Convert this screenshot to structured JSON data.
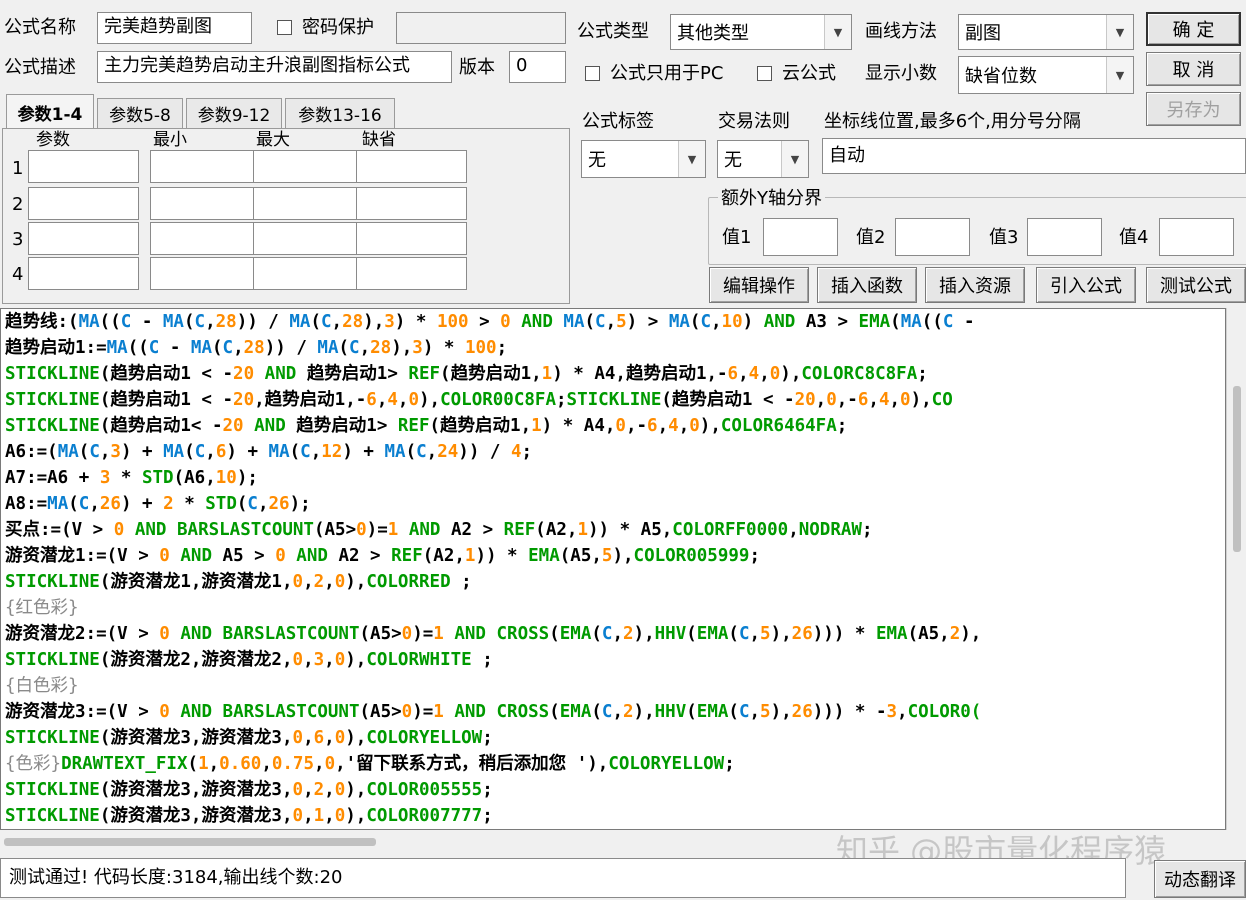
{
  "form": {
    "name_label": "公式名称",
    "name_value": "完美趋势副图",
    "pwd_label": "密码保护",
    "desc_label": "公式描述",
    "desc_value": "主力完美趋势启动主升浪副图指标公式",
    "version_label": "版本",
    "version_value": "0",
    "type_label": "公式类型",
    "type_value": "其他类型",
    "draw_label": "画线方法",
    "draw_value": "副图",
    "pc_only_label": "公式只用于PC",
    "cloud_label": "云公式",
    "decimals_label": "显示小数",
    "decimals_value": "缺省位数",
    "tag_label": "公式标签",
    "tag_value": "无",
    "trade_label": "交易法则",
    "trade_value": "无",
    "axis_label": "坐标线位置,最多6个,用分号分隔",
    "axis_value": "自动",
    "yaxis_group": "额外Y轴分界",
    "v1": "值1",
    "v2": "值2",
    "v3": "值3",
    "v4": "值4"
  },
  "buttons": {
    "ok": "确 定",
    "cancel": "取 消",
    "saveas": "另存为",
    "edit": "编辑操作",
    "insert_func": "插入函数",
    "insert_res": "插入资源",
    "import": "引入公式",
    "test": "测试公式",
    "translate": "动态翻译"
  },
  "tabs": [
    "参数1-4",
    "参数5-8",
    "参数9-12",
    "参数13-16"
  ],
  "params": {
    "headers": [
      "参数",
      "最小",
      "最大",
      "缺省"
    ],
    "rows": [
      "1",
      "2",
      "3",
      "4"
    ]
  },
  "code_lines": [
    [
      [
        "k",
        "趋势线:("
      ],
      [
        "f",
        "MA"
      ],
      [
        "k",
        "(("
      ],
      [
        "f",
        "C"
      ],
      [
        "k",
        " - "
      ],
      [
        "f",
        "MA"
      ],
      [
        "k",
        "("
      ],
      [
        "f",
        "C"
      ],
      [
        "k",
        ","
      ],
      [
        "n",
        "28"
      ],
      [
        "k",
        ")) / "
      ],
      [
        "f",
        "MA"
      ],
      [
        "k",
        "("
      ],
      [
        "f",
        "C"
      ],
      [
        "k",
        ","
      ],
      [
        "n",
        "28"
      ],
      [
        "k",
        "),"
      ],
      [
        "n",
        "3"
      ],
      [
        "k",
        ") * "
      ],
      [
        "n",
        "100"
      ],
      [
        "k",
        " > "
      ],
      [
        "n",
        "0"
      ],
      [
        "g",
        " AND "
      ],
      [
        "f",
        "MA"
      ],
      [
        "k",
        "("
      ],
      [
        "f",
        "C"
      ],
      [
        "k",
        ","
      ],
      [
        "n",
        "5"
      ],
      [
        "k",
        ") > "
      ],
      [
        "f",
        "MA"
      ],
      [
        "k",
        "("
      ],
      [
        "f",
        "C"
      ],
      [
        "k",
        ","
      ],
      [
        "n",
        "10"
      ],
      [
        "k",
        ")"
      ],
      [
        "g",
        " AND "
      ],
      [
        "k",
        "A3 > "
      ],
      [
        "g",
        "EMA"
      ],
      [
        "k",
        "("
      ],
      [
        "f",
        "MA"
      ],
      [
        "k",
        "(("
      ],
      [
        "f",
        "C"
      ],
      [
        "k",
        " -"
      ]
    ],
    [
      [
        "k",
        "趋势启动1:="
      ],
      [
        "f",
        "MA"
      ],
      [
        "k",
        "(("
      ],
      [
        "f",
        "C"
      ],
      [
        "k",
        " - "
      ],
      [
        "f",
        "MA"
      ],
      [
        "k",
        "("
      ],
      [
        "f",
        "C"
      ],
      [
        "k",
        ","
      ],
      [
        "n",
        "28"
      ],
      [
        "k",
        ")) / "
      ],
      [
        "f",
        "MA"
      ],
      [
        "k",
        "("
      ],
      [
        "f",
        "C"
      ],
      [
        "k",
        ","
      ],
      [
        "n",
        "28"
      ],
      [
        "k",
        "),"
      ],
      [
        "n",
        "3"
      ],
      [
        "k",
        ") * "
      ],
      [
        "n",
        "100"
      ],
      [
        "k",
        ";"
      ]
    ],
    [
      [
        "g",
        "STICKLINE"
      ],
      [
        "k",
        "(趋势启动1 < -"
      ],
      [
        "n",
        "20"
      ],
      [
        "g",
        " AND "
      ],
      [
        "k",
        "趋势启动1> "
      ],
      [
        "g",
        "REF"
      ],
      [
        "k",
        "(趋势启动1,"
      ],
      [
        "n",
        "1"
      ],
      [
        "k",
        ") * A4,趋势启动1,-"
      ],
      [
        "n",
        "6"
      ],
      [
        "k",
        ","
      ],
      [
        "n",
        "4"
      ],
      [
        "k",
        ","
      ],
      [
        "n",
        "0"
      ],
      [
        "k",
        "),"
      ],
      [
        "g",
        "COLORC8C8FA"
      ],
      [
        "k",
        ";"
      ]
    ],
    [
      [
        "g",
        "STICKLINE"
      ],
      [
        "k",
        "(趋势启动1 < -"
      ],
      [
        "n",
        "20"
      ],
      [
        "k",
        ",趋势启动1,-"
      ],
      [
        "n",
        "6"
      ],
      [
        "k",
        ","
      ],
      [
        "n",
        "4"
      ],
      [
        "k",
        ","
      ],
      [
        "n",
        "0"
      ],
      [
        "k",
        "),"
      ],
      [
        "g",
        "COLOR00C8FA"
      ],
      [
        "k",
        ";"
      ],
      [
        "g",
        "STICKLINE"
      ],
      [
        "k",
        "(趋势启动1 < -"
      ],
      [
        "n",
        "20"
      ],
      [
        "k",
        ","
      ],
      [
        "n",
        "0"
      ],
      [
        "k",
        ",-"
      ],
      [
        "n",
        "6"
      ],
      [
        "k",
        ","
      ],
      [
        "n",
        "4"
      ],
      [
        "k",
        ","
      ],
      [
        "n",
        "0"
      ],
      [
        "k",
        "),"
      ],
      [
        "g",
        "CO"
      ]
    ],
    [
      [
        "g",
        "STICKLINE"
      ],
      [
        "k",
        "(趋势启动1< -"
      ],
      [
        "n",
        "20"
      ],
      [
        "g",
        " AND "
      ],
      [
        "k",
        "趋势启动1> "
      ],
      [
        "g",
        "REF"
      ],
      [
        "k",
        "(趋势启动1,"
      ],
      [
        "n",
        "1"
      ],
      [
        "k",
        ") * A4,"
      ],
      [
        "n",
        "0"
      ],
      [
        "k",
        ",-"
      ],
      [
        "n",
        "6"
      ],
      [
        "k",
        ","
      ],
      [
        "n",
        "4"
      ],
      [
        "k",
        ","
      ],
      [
        "n",
        "0"
      ],
      [
        "k",
        "),"
      ],
      [
        "g",
        "COLOR6464FA"
      ],
      [
        "k",
        ";"
      ]
    ],
    [
      [
        "k",
        "A6:=("
      ],
      [
        "f",
        "MA"
      ],
      [
        "k",
        "("
      ],
      [
        "f",
        "C"
      ],
      [
        "k",
        ","
      ],
      [
        "n",
        "3"
      ],
      [
        "k",
        ") + "
      ],
      [
        "f",
        "MA"
      ],
      [
        "k",
        "("
      ],
      [
        "f",
        "C"
      ],
      [
        "k",
        ","
      ],
      [
        "n",
        "6"
      ],
      [
        "k",
        ") + "
      ],
      [
        "f",
        "MA"
      ],
      [
        "k",
        "("
      ],
      [
        "f",
        "C"
      ],
      [
        "k",
        ","
      ],
      [
        "n",
        "12"
      ],
      [
        "k",
        ") + "
      ],
      [
        "f",
        "MA"
      ],
      [
        "k",
        "("
      ],
      [
        "f",
        "C"
      ],
      [
        "k",
        ","
      ],
      [
        "n",
        "24"
      ],
      [
        "k",
        ")) / "
      ],
      [
        "n",
        "4"
      ],
      [
        "k",
        ";"
      ]
    ],
    [
      [
        "k",
        "A7:=A6 + "
      ],
      [
        "n",
        "3"
      ],
      [
        "k",
        " * "
      ],
      [
        "g",
        "STD"
      ],
      [
        "k",
        "(A6,"
      ],
      [
        "n",
        "10"
      ],
      [
        "k",
        ");"
      ]
    ],
    [
      [
        "k",
        "A8:="
      ],
      [
        "f",
        "MA"
      ],
      [
        "k",
        "("
      ],
      [
        "f",
        "C"
      ],
      [
        "k",
        ","
      ],
      [
        "n",
        "26"
      ],
      [
        "k",
        ") + "
      ],
      [
        "n",
        "2"
      ],
      [
        "k",
        " * "
      ],
      [
        "g",
        "STD"
      ],
      [
        "k",
        "("
      ],
      [
        "f",
        "C"
      ],
      [
        "k",
        ","
      ],
      [
        "n",
        "26"
      ],
      [
        "k",
        ");"
      ]
    ],
    [
      [
        "k",
        "买点:=(V > "
      ],
      [
        "n",
        "0"
      ],
      [
        "g",
        " AND "
      ],
      [
        "g",
        "BARSLASTCOUNT"
      ],
      [
        "k",
        "(A5>"
      ],
      [
        "n",
        "0"
      ],
      [
        "k",
        ")="
      ],
      [
        "n",
        "1"
      ],
      [
        "g",
        " AND "
      ],
      [
        "k",
        "A2 > "
      ],
      [
        "g",
        "REF"
      ],
      [
        "k",
        "(A2,"
      ],
      [
        "n",
        "1"
      ],
      [
        "k",
        ")) * A5,"
      ],
      [
        "g",
        "COLORFF0000"
      ],
      [
        "k",
        ","
      ],
      [
        "g",
        "NODRAW"
      ],
      [
        "k",
        ";"
      ]
    ],
    [
      [
        "k",
        "游资潜龙1:=(V > "
      ],
      [
        "n",
        "0"
      ],
      [
        "g",
        " AND "
      ],
      [
        "k",
        "A5 > "
      ],
      [
        "n",
        "0"
      ],
      [
        "g",
        " AND "
      ],
      [
        "k",
        "A2 > "
      ],
      [
        "g",
        "REF"
      ],
      [
        "k",
        "(A2,"
      ],
      [
        "n",
        "1"
      ],
      [
        "k",
        ")) * "
      ],
      [
        "g",
        "EMA"
      ],
      [
        "k",
        "(A5,"
      ],
      [
        "n",
        "5"
      ],
      [
        "k",
        "),"
      ],
      [
        "g",
        "COLOR005999"
      ],
      [
        "k",
        ";"
      ]
    ],
    [
      [
        "g",
        "STICKLINE"
      ],
      [
        "k",
        "(游资潜龙1,游资潜龙1,"
      ],
      [
        "n",
        "0"
      ],
      [
        "k",
        ","
      ],
      [
        "n",
        "2"
      ],
      [
        "k",
        ","
      ],
      [
        "n",
        "0"
      ],
      [
        "k",
        "),"
      ],
      [
        "g",
        "COLORRED"
      ],
      [
        "k",
        " ;"
      ]
    ],
    [
      [
        "c",
        "{红色彩}"
      ]
    ],
    [
      [
        "k",
        "游资潜龙2:=(V > "
      ],
      [
        "n",
        "0"
      ],
      [
        "g",
        " AND "
      ],
      [
        "g",
        "BARSLASTCOUNT"
      ],
      [
        "k",
        "(A5>"
      ],
      [
        "n",
        "0"
      ],
      [
        "k",
        ")="
      ],
      [
        "n",
        "1"
      ],
      [
        "g",
        " AND "
      ],
      [
        "g",
        "CROSS"
      ],
      [
        "k",
        "("
      ],
      [
        "g",
        "EMA"
      ],
      [
        "k",
        "("
      ],
      [
        "f",
        "C"
      ],
      [
        "k",
        ","
      ],
      [
        "n",
        "2"
      ],
      [
        "k",
        "),"
      ],
      [
        "g",
        "HHV"
      ],
      [
        "k",
        "("
      ],
      [
        "g",
        "EMA"
      ],
      [
        "k",
        "("
      ],
      [
        "f",
        "C"
      ],
      [
        "k",
        ","
      ],
      [
        "n",
        "5"
      ],
      [
        "k",
        "),"
      ],
      [
        "n",
        "26"
      ],
      [
        "k",
        ")))"
      ],
      [
        "k",
        " * "
      ],
      [
        "g",
        "EMA"
      ],
      [
        "k",
        "(A5,"
      ],
      [
        "n",
        "2"
      ],
      [
        "k",
        "),"
      ]
    ],
    [
      [
        "g",
        "STICKLINE"
      ],
      [
        "k",
        "(游资潜龙2,游资潜龙2,"
      ],
      [
        "n",
        "0"
      ],
      [
        "k",
        ","
      ],
      [
        "n",
        "3"
      ],
      [
        "k",
        ","
      ],
      [
        "n",
        "0"
      ],
      [
        "k",
        "),"
      ],
      [
        "g",
        "COLORWHITE"
      ],
      [
        "k",
        " ;"
      ]
    ],
    [
      [
        "c",
        "{白色彩}"
      ]
    ],
    [
      [
        "k",
        "游资潜龙3:=(V > "
      ],
      [
        "n",
        "0"
      ],
      [
        "g",
        " AND "
      ],
      [
        "g",
        "BARSLASTCOUNT"
      ],
      [
        "k",
        "(A5>"
      ],
      [
        "n",
        "0"
      ],
      [
        "k",
        ")="
      ],
      [
        "n",
        "1"
      ],
      [
        "g",
        " AND "
      ],
      [
        "g",
        "CROSS"
      ],
      [
        "k",
        "("
      ],
      [
        "g",
        "EMA"
      ],
      [
        "k",
        "("
      ],
      [
        "f",
        "C"
      ],
      [
        "k",
        ","
      ],
      [
        "n",
        "2"
      ],
      [
        "k",
        "),"
      ],
      [
        "g",
        "HHV"
      ],
      [
        "k",
        "("
      ],
      [
        "g",
        "EMA"
      ],
      [
        "k",
        "("
      ],
      [
        "f",
        "C"
      ],
      [
        "k",
        ","
      ],
      [
        "n",
        "5"
      ],
      [
        "k",
        "),"
      ],
      [
        "n",
        "26"
      ],
      [
        "k",
        ")))"
      ],
      [
        "k",
        " * -"
      ],
      [
        "n",
        "3"
      ],
      [
        "k",
        ","
      ],
      [
        "g",
        "COLOR0("
      ]
    ],
    [
      [
        "g",
        "STICKLINE"
      ],
      [
        "k",
        "(游资潜龙3,游资潜龙3,"
      ],
      [
        "n",
        "0"
      ],
      [
        "k",
        ","
      ],
      [
        "n",
        "6"
      ],
      [
        "k",
        ","
      ],
      [
        "n",
        "0"
      ],
      [
        "k",
        "),"
      ],
      [
        "g",
        "COLORYELLOW"
      ],
      [
        "k",
        ";"
      ]
    ],
    [
      [
        "c",
        "{色彩}"
      ],
      [
        "g",
        "DRAWTEXT_FIX"
      ],
      [
        "k",
        "("
      ],
      [
        "n",
        "1"
      ],
      [
        "k",
        ","
      ],
      [
        "n",
        "0.60"
      ],
      [
        "k",
        ","
      ],
      [
        "n",
        "0.75"
      ],
      [
        "k",
        ","
      ],
      [
        "n",
        "0"
      ],
      [
        "k",
        ",'留下联系方式，稍后添加您 '),"
      ],
      [
        "g",
        "COLORYELLOW"
      ],
      [
        "k",
        ";"
      ]
    ],
    [
      [
        "g",
        "STICKLINE"
      ],
      [
        "k",
        "(游资潜龙3,游资潜龙3,"
      ],
      [
        "n",
        "0"
      ],
      [
        "k",
        ","
      ],
      [
        "n",
        "2"
      ],
      [
        "k",
        ","
      ],
      [
        "n",
        "0"
      ],
      [
        "k",
        "),"
      ],
      [
        "g",
        "COLOR005555"
      ],
      [
        "k",
        ";"
      ]
    ],
    [
      [
        "g",
        "STICKLINE"
      ],
      [
        "k",
        "(游资潜龙3,游资潜龙3,"
      ],
      [
        "n",
        "0"
      ],
      [
        "k",
        ","
      ],
      [
        "n",
        "1"
      ],
      [
        "k",
        ","
      ],
      [
        "n",
        "0"
      ],
      [
        "k",
        "),"
      ],
      [
        "g",
        "COLOR007777"
      ],
      [
        "k",
        ";"
      ]
    ]
  ],
  "status_text": "测试通过! 代码长度:3184,输出线个数:20",
  "watermark": "知乎 @股市量化程序猿"
}
